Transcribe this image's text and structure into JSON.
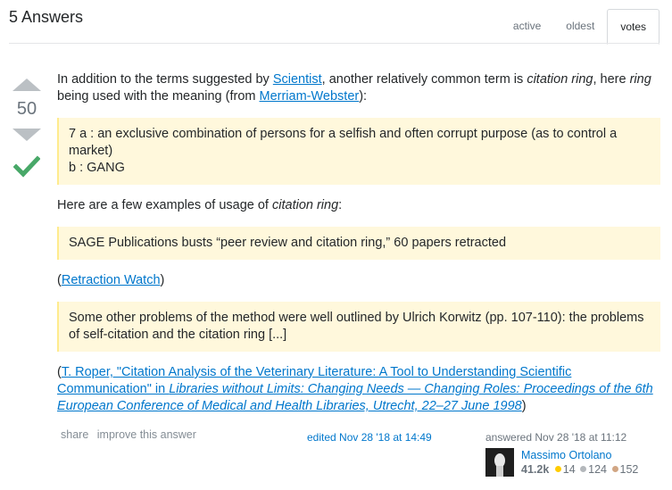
{
  "header": {
    "title": "5 Answers",
    "tabs": [
      {
        "label": "active",
        "selected": false
      },
      {
        "label": "oldest",
        "selected": false
      },
      {
        "label": "votes",
        "selected": true
      }
    ]
  },
  "votes": {
    "count": "50",
    "accepted": true
  },
  "answer": {
    "p1_pre": "In addition to the terms suggested by ",
    "p1_link1": "Scientist",
    "p1_mid1": ", another relatively common term is ",
    "p1_em1": "citation ring",
    "p1_mid2": ", here ",
    "p1_em2": "ring",
    "p1_mid3": " being used with the meaning (from ",
    "p1_link2": "Merriam-Webster",
    "p1_end": "):",
    "quote1_line1": "7 a : an exclusive combination of persons for a selfish and often corrupt purpose (as to control a market)",
    "quote1_line2": "b : GANG",
    "p2_pre": "Here are a few examples of usage of ",
    "p2_em": "citation ring",
    "p2_end": ":",
    "quote2": "SAGE Publications busts “peer review and citation ring,” 60 papers retracted",
    "source1_open": "(",
    "source1_link": "Retraction Watch",
    "source1_close": ")",
    "quote3": "Some other problems of the method were well outlined by Ulrich Korwitz (pp. 107-110): the problems of self-citation and the citation ring [...]",
    "source2_open": "(",
    "source2_link_text": "T. Roper, \"Citation Analysis of the Veterinary Literature: A Tool to Understanding Scientific Communication\" in ",
    "source2_link_em": "Libraries without Limits: Changing Needs — Changing Roles: Proceedings of the 6th European Conference of Medical and Health Libraries, Utrecht, 22–27 June 1998",
    "source2_close": ")"
  },
  "menu": {
    "share": "share",
    "improve": "improve this answer"
  },
  "edited": "edited Nov 28 '18 at 14:49",
  "user": {
    "answered": "answered Nov 28 '18 at 11:12",
    "name": "Massimo Ortolano",
    "reputation": "41.2k",
    "gold": "14",
    "silver": "124",
    "bronze": "152"
  },
  "colors": {
    "link": "#0077cc",
    "quote_bg": "#fff8dc",
    "accepted_check": "#48a868",
    "gold": "#ffcc01",
    "silver": "#b4b8bc",
    "bronze": "#d1a684"
  }
}
